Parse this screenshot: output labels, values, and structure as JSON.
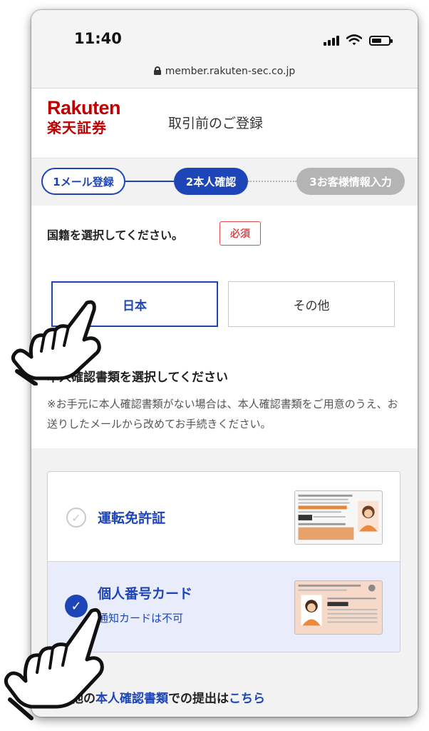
{
  "status_bar": {
    "time": "11:40",
    "url": "member.rakuten-sec.co.jp",
    "icons": [
      "signal-icon",
      "wifi-icon",
      "battery-icon"
    ]
  },
  "header": {
    "logo_en": "Rakuten",
    "logo_jp": "楽天証券",
    "title": "取引前のご登録",
    "brand_color": "#bf0000"
  },
  "steps": [
    {
      "label": "1メール登録",
      "state": "done"
    },
    {
      "label": "2本人確認",
      "state": "current"
    },
    {
      "label": "3お客様情報入力",
      "state": "upcoming"
    }
  ],
  "nationality": {
    "label": "国籍を選択してください。",
    "required_badge": "必須",
    "options": [
      "日本",
      "その他"
    ],
    "selected": "日本"
  },
  "documents": {
    "heading": "本人確認書類を選択してください",
    "note": "※お手元に本人確認書類がない場合は、本人確認書類をご用意のうえ、お送りしたメールから改めてお手続きください。",
    "options": [
      {
        "title": "運転免許証",
        "subtitle": "",
        "selected": false
      },
      {
        "title": "個人番号カード",
        "subtitle": "通知カードは不可",
        "selected": true
      }
    ]
  },
  "footer_link": {
    "prefix": "その他の",
    "link1": "本人確認書類",
    "middle": "での提出は",
    "link2": "こちら"
  },
  "colors": {
    "accent": "#1d45b8",
    "required": "#e24b4b",
    "selected_bg": "#e9ecfa",
    "inactive_step": "#b4b4b4"
  }
}
